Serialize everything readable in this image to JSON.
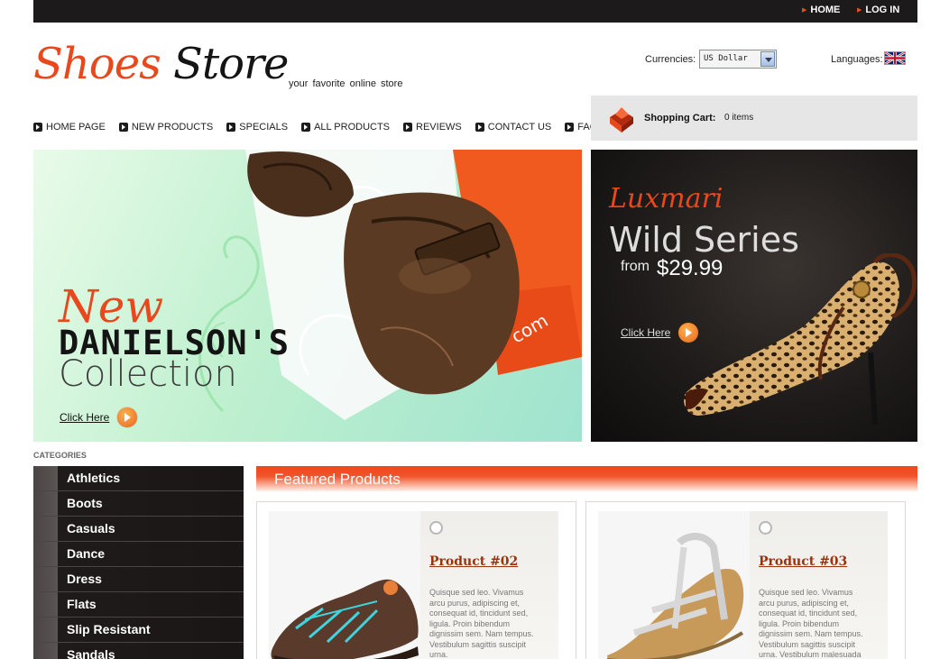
{
  "topbar": {
    "home": "HOME",
    "login": "LOG IN"
  },
  "logo": {
    "part1": "Shoes",
    "part2": "Store",
    "tagline": "your favorite online store"
  },
  "currencies": {
    "label": "Currencies:",
    "selected": "US Dollar"
  },
  "languages": {
    "label": "Languages:",
    "flag_icon": "uk-flag-icon"
  },
  "nav": [
    "HOME PAGE",
    "NEW PRODUCTS",
    "SPECIALS",
    "ALL PRODUCTS",
    "REVIEWS",
    "CONTACT US",
    "FAQ"
  ],
  "cart": {
    "label": "Shopping Cart:",
    "count": "0 items",
    "icon": "shopping-bag-icon"
  },
  "banner_left": {
    "headline": "New",
    "name": "DANIELSON'S",
    "sub": "Collection",
    "link": "Click Here",
    "bag_text": "com"
  },
  "banner_right": {
    "brand": "Luxmari",
    "title": "Wild Series",
    "from": "from",
    "price": "$29.99",
    "link": "Click Here"
  },
  "categories": {
    "title": "CATEGORIES",
    "items": [
      "Athletics",
      "Boots",
      "Casuals",
      "Dance",
      "Dress",
      "Flats",
      "Slip Resistant",
      "Sandals"
    ]
  },
  "featured": {
    "title": "Featured Products",
    "products": [
      {
        "name": "Product #02",
        "desc": "Quisque sed leo. Vivamus arcu purus, adipiscing et, consequat id, tincidunt sed, ligula. Proin bibendum dignissim sem. Nam tempus. Vestibulum sagittis suscipit urna."
      },
      {
        "name": "Product #03",
        "desc": "Quisque sed leo. Vivamus arcu purus, adipiscing et, consequat id, tincidunt sed, ligula. Proin bibendum dignissim sem. Nam tempus. Vestibulum sagittis suscipit urna. Vestibulum malesuada"
      }
    ]
  },
  "colors": {
    "accent": "#e8481c",
    "dark": "#1c1a1a",
    "cart_bg": "#e6e6e6"
  }
}
